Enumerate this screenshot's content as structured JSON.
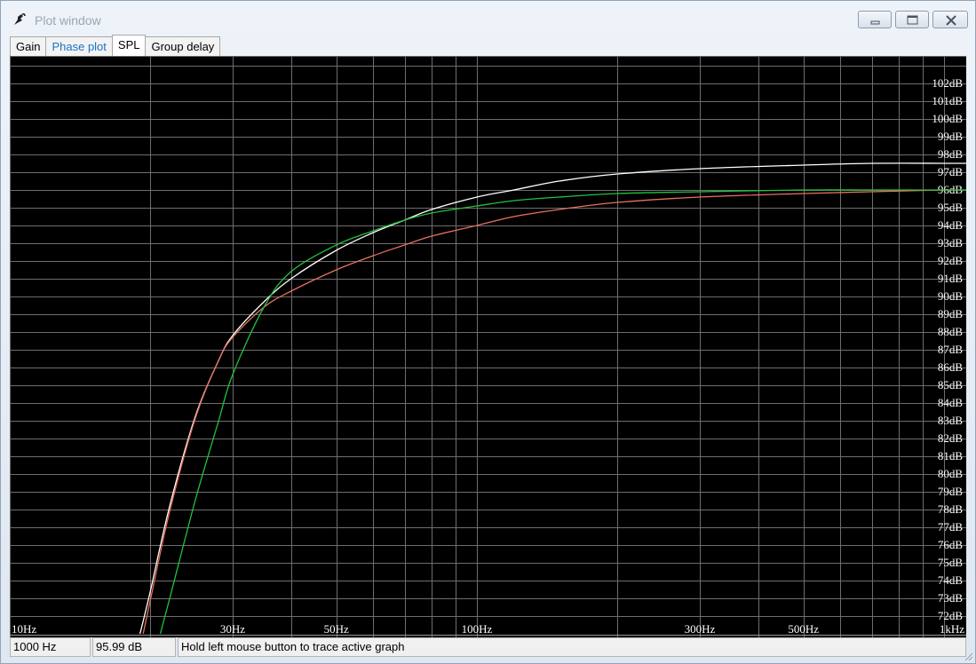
{
  "window": {
    "title": "Plot window",
    "app_icon": "speaker-cone-icon",
    "controls": [
      "minimize-icon",
      "maximize-icon",
      "close-icon"
    ]
  },
  "tabs": [
    {
      "label": "Gain",
      "active": false
    },
    {
      "label": "Phase plot",
      "active": false
    },
    {
      "label": "SPL",
      "active": true
    },
    {
      "label": "Group delay",
      "active": false
    }
  ],
  "status": {
    "frequency": "1000 Hz",
    "level": "95.99 dB",
    "hint": "Hold left mouse button to trace active graph"
  },
  "chart_data": {
    "type": "line",
    "xscale": "log",
    "xlim": [
      10,
      1000
    ],
    "ylim": [
      71,
      103
    ],
    "x_ticks": [
      {
        "value": 10,
        "label": "10Hz"
      },
      {
        "value": 30,
        "label": "30Hz"
      },
      {
        "value": 50,
        "label": "50Hz"
      },
      {
        "value": 100,
        "label": "100Hz"
      },
      {
        "value": 300,
        "label": "300Hz"
      },
      {
        "value": 500,
        "label": "500Hz"
      },
      {
        "value": 1000,
        "label": "1kHz"
      }
    ],
    "y_ticks": [
      102,
      101,
      100,
      99,
      98,
      97,
      96,
      95,
      94,
      93,
      92,
      91,
      90,
      89,
      88,
      87,
      86,
      85,
      84,
      83,
      82,
      81,
      80,
      79,
      78,
      77,
      76,
      75,
      74,
      73,
      72
    ],
    "y_unit": "dB",
    "grid": true,
    "background": "#000000",
    "grid_color": "#6e6e6e",
    "series": [
      {
        "color": "#ffffff",
        "x": [
          19,
          20,
          22,
          25,
          28,
          30,
          35,
          40,
          50,
          60,
          70,
          80,
          100,
          120,
          150,
          200,
          300,
          500,
          700,
          1000
        ],
        "y": [
          71,
          73.4,
          78.2,
          83.3,
          86.4,
          87.8,
          89.7,
          91.0,
          92.6,
          93.6,
          94.3,
          94.9,
          95.6,
          96.0,
          96.5,
          96.9,
          97.2,
          97.4,
          97.5,
          97.5
        ]
      },
      {
        "color": "#e87060",
        "x": [
          19.3,
          20,
          22,
          25,
          28,
          30,
          35,
          40,
          50,
          60,
          70,
          80,
          100,
          120,
          150,
          200,
          300,
          500,
          700,
          1000
        ],
        "y": [
          71,
          72.9,
          77.9,
          83.2,
          86.4,
          87.7,
          89.4,
          90.3,
          91.5,
          92.3,
          92.9,
          93.4,
          94.0,
          94.5,
          94.9,
          95.3,
          95.6,
          95.8,
          95.9,
          96.0
        ]
      },
      {
        "color": "#22c23c",
        "x": [
          21,
          22,
          25,
          28,
          30,
          35,
          40,
          50,
          60,
          70,
          80,
          100,
          120,
          150,
          200,
          300,
          500,
          700,
          1000
        ],
        "y": [
          71,
          73.0,
          78.6,
          83.0,
          85.6,
          89.4,
          91.4,
          92.9,
          93.7,
          94.3,
          94.7,
          95.1,
          95.4,
          95.6,
          95.8,
          95.9,
          96.0,
          96.0,
          96.0
        ]
      }
    ]
  }
}
